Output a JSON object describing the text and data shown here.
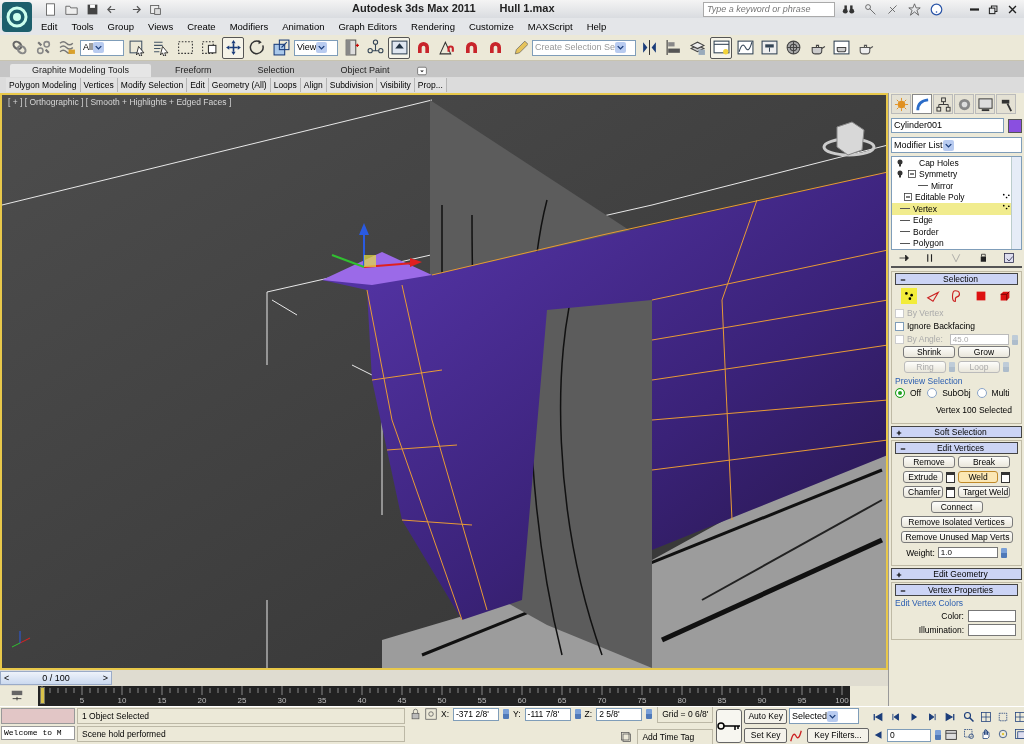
{
  "title_bar": {
    "app_title": "Autodesk 3ds Max  2011",
    "file_name": "Hull 1.max",
    "search": {
      "placeholder": "Type a keyword or phrase"
    }
  },
  "menu": [
    "Edit",
    "Tools",
    "Group",
    "Views",
    "Create",
    "Modifiers",
    "Animation",
    "Graph Editors",
    "Rendering",
    "Customize",
    "MAXScript",
    "Help"
  ],
  "toolbar": [
    {
      "kind": "link",
      "pressed": false
    },
    {
      "kind": "unlink",
      "pressed": false
    },
    {
      "kind": "bind",
      "pressed": false
    },
    {
      "kind": "dropdown",
      "value": "All"
    },
    {
      "kind": "select",
      "pressed": false
    },
    {
      "kind": "select_by_name",
      "pressed": false
    },
    {
      "kind": "region",
      "pressed": false
    },
    {
      "kind": "crossing",
      "pressed": false
    },
    {
      "kind": "move",
      "pressed": true
    },
    {
      "kind": "rotate",
      "pressed": false
    },
    {
      "kind": "scale",
      "pressed": false
    },
    {
      "kind": "dropdown",
      "value": "View"
    },
    {
      "kind": "pivot",
      "pressed": false
    },
    {
      "kind": "manipulate",
      "pressed": false
    },
    {
      "kind": "override",
      "pressed": true
    },
    {
      "kind": "snap",
      "pressed": false
    },
    {
      "kind": "angle_snap",
      "pressed": false
    },
    {
      "kind": "snap",
      "pressed": false
    },
    {
      "kind": "snap",
      "pressed": false
    },
    {
      "kind": "named_sel",
      "pressed": false
    },
    {
      "kind": "combo",
      "placeholder": "Create Selection Se"
    },
    {
      "kind": "mirror",
      "pressed": false
    },
    {
      "kind": "align",
      "pressed": false
    },
    {
      "kind": "layers",
      "pressed": false
    },
    {
      "kind": "ribbon",
      "pressed": true
    },
    {
      "kind": "curve",
      "pressed": false
    },
    {
      "kind": "schematic",
      "pressed": false
    },
    {
      "kind": "material",
      "pressed": false
    },
    {
      "kind": "render_setup",
      "pressed": false
    },
    {
      "kind": "frame_window",
      "pressed": false
    },
    {
      "kind": "render",
      "pressed": false
    }
  ],
  "ribbon": {
    "tabs": [
      {
        "label": "Graphite Modeling Tools",
        "selected": true
      },
      {
        "label": "Freeform",
        "selected": false
      },
      {
        "label": "Selection",
        "selected": false
      },
      {
        "label": "Object Paint",
        "selected": false
      }
    ],
    "panels": [
      "Polygon Modeling",
      "Vertices",
      "Modify Selection",
      "Edit",
      "Geometry (All)",
      "Loops",
      "Align",
      "Subdivision",
      "Visibility",
      "Prop..."
    ]
  },
  "viewport": {
    "label": "[ + ] [ Orthographic ] [ Smooth + Highlights + Edged Faces ]",
    "active": true
  },
  "command_panel": {
    "tabs": [
      {
        "kind": "create",
        "selected": false
      },
      {
        "kind": "modify",
        "selected": true
      },
      {
        "kind": "hierarchy",
        "selected": false
      },
      {
        "kind": "motion",
        "selected": false
      },
      {
        "kind": "display",
        "selected": false
      },
      {
        "kind": "utilities",
        "selected": false
      }
    ],
    "object_name": "Cylinder001",
    "modifier_list": "Modifier List",
    "stack": [
      {
        "label": "Cap Holes",
        "bulb": true,
        "selected": false
      },
      {
        "label": "Symmetry",
        "bulb": true,
        "selected": false,
        "expanded": true,
        "children": [
          {
            "label": "Mirror",
            "selected": false
          }
        ]
      },
      {
        "label": "Editable Poly",
        "bulb": false,
        "selected": false,
        "expanded": true,
        "children": [
          {
            "label": "Vertex",
            "selected": true
          },
          {
            "label": "Edge",
            "selected": false
          },
          {
            "label": "Border",
            "selected": false
          },
          {
            "label": "Polygon",
            "selected": false
          }
        ]
      }
    ],
    "rollouts": [
      {
        "kind": "selection",
        "title": "Selection",
        "expanded": true,
        "subobjects": [
          {
            "kind": "vertex",
            "selected": true
          },
          {
            "kind": "edge",
            "selected": false
          },
          {
            "kind": "border",
            "selected": false
          },
          {
            "kind": "polygon",
            "selected": false
          },
          {
            "kind": "element",
            "selected": false
          }
        ],
        "options": [
          {
            "label": "By Vertex",
            "checked": false,
            "disabled": true
          },
          {
            "label": "Ignore Backfacing",
            "checked": false,
            "disabled": false
          },
          {
            "label": "By Angle:",
            "checked": false,
            "disabled": true,
            "value": "45.0"
          }
        ],
        "button_rows": [
          [
            {
              "label": "Shrink",
              "disabled": false,
              "spinner": false
            },
            {
              "label": "Grow",
              "disabled": false,
              "spinner": false
            }
          ],
          [
            {
              "label": "Ring",
              "disabled": true,
              "spinner": true
            },
            {
              "label": "Loop",
              "disabled": true,
              "spinner": true
            }
          ]
        ],
        "preview": {
          "title": "Preview Selection",
          "options": [
            {
              "label": "Off",
              "selected": true
            },
            {
              "label": "SubObj",
              "selected": false
            },
            {
              "label": "Multi",
              "selected": false
            }
          ]
        },
        "status": "Vertex 100 Selected"
      },
      {
        "kind": "soft_selection",
        "title": "Soft Selection",
        "expanded": false
      },
      {
        "kind": "edit_vertices",
        "title": "Edit Vertices",
        "expanded": true,
        "button_rows": [
          [
            {
              "label": "Remove",
              "settings": false,
              "active": false
            },
            {
              "label": "Break",
              "settings": false,
              "active": false
            }
          ],
          [
            {
              "label": "Extrude",
              "settings": true,
              "active": false
            },
            {
              "label": "Weld",
              "settings": true,
              "active": true
            }
          ],
          [
            {
              "label": "Chamfer",
              "settings": true,
              "active": false
            },
            {
              "label": "Target Weld",
              "settings": false,
              "active": false
            }
          ],
          [
            {
              "label": "Connect",
              "settings": false,
              "active": false
            }
          ],
          [
            {
              "label": "Remove Isolated Vertices",
              "settings": false,
              "active": false
            }
          ],
          [
            {
              "label": "Remove Unused Map Verts",
              "settings": false,
              "active": false
            }
          ]
        ],
        "weight": {
          "label": "Weight:",
          "value": "1.0"
        }
      },
      {
        "kind": "edit_geometry",
        "title": "Edit Geometry",
        "expanded": false
      },
      {
        "kind": "vertex_properties",
        "title": "Vertex Properties",
        "expanded": true,
        "group": "Edit Vertex Colors",
        "fields": [
          {
            "label": "Color:"
          },
          {
            "label": "Illumination:"
          }
        ]
      }
    ]
  },
  "time_slider": {
    "prev": "<",
    "label": "0 / 100",
    "next": ">",
    "level": 0
  },
  "track_bar": {
    "ticks": [
      "5",
      "10",
      "15",
      "20",
      "25",
      "30",
      "35",
      "40",
      "45",
      "50",
      "55",
      "60",
      "65",
      "70",
      "75",
      "80",
      "85",
      "90",
      "95",
      "100"
    ]
  },
  "status": {
    "listener": "Welcome to M",
    "prompt_line": "1 Object Selected",
    "status_line": "Scene hold performed",
    "coords": [
      {
        "label": "X:",
        "value": "-371 2/8'"
      },
      {
        "label": "Y:",
        "value": "-111 7/8'"
      },
      {
        "label": "Z:",
        "value": "2 5/8'"
      }
    ],
    "grid": "Grid = 0 6/8'",
    "time_tag": "Add Time Tag"
  },
  "animation": {
    "auto_key": {
      "label": "Auto Key",
      "on": false
    },
    "set_key": "Set Key",
    "key_mode": "Selected",
    "key_filters": "Key Filters...",
    "frame": "0"
  }
}
